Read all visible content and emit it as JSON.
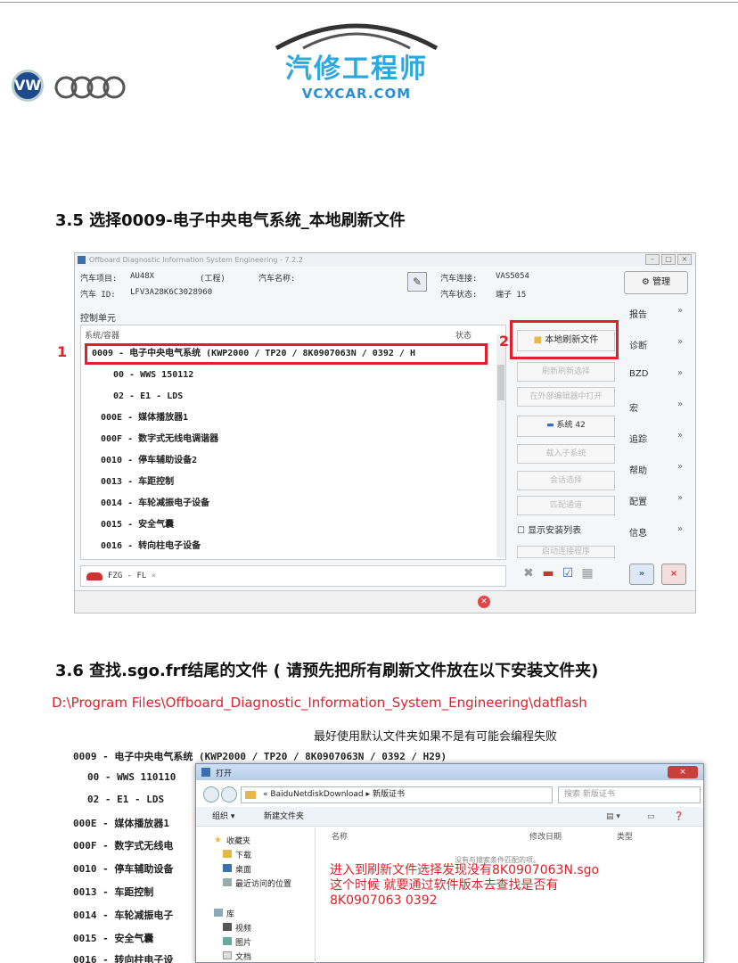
{
  "header": {
    "brand_cn": "汽修工程师",
    "brand_en": "VCXCAR.COM",
    "vw_logo": "VW",
    "audi_logo": "audi-rings"
  },
  "section1": {
    "heading": "3.5 选择0009-电子中央电气系统_本地刷新文件"
  },
  "window": {
    "title": "Offboard Diagnostic Information System Engineering - 7.2.2",
    "min": "–",
    "max": "□",
    "close": "×",
    "project_label": "汽车项目:",
    "project_value": "AU48X",
    "project_extra": "(工程)",
    "id_label": "汽车 ID:",
    "id_value": "LFV3A28K6C3028960",
    "name_label": "汽车名称:",
    "conn_label": "汽车连接:",
    "conn_value": "VAS5054",
    "state_label": "汽车状态:",
    "state_value": "端子 15",
    "mgmt_label": "管理",
    "control_units_label": "控制单元",
    "col_system": "系统/容器",
    "col_status": "状态",
    "rows": [
      "0009 - 电子中央电气系统  (KWP2000 / TP20 / 8K0907063N / 0392 / H",
      "00 - WWS 150112",
      "02 - E1 - LDS",
      "000E - 媒体播放器1",
      "000F - 数字式无线电调谐器",
      "0010 - 停车辅助设备2",
      "0013 - 车距控制",
      "0014 - 车轮减振电子设备",
      "0015 - 安全气囊",
      "0016 - 转向柱电子设备"
    ],
    "marker1": "1",
    "marker2": "2",
    "btn_local_flash": "本地刷新文件",
    "btn_refresh_sel": "刷新刷新选择",
    "btn_open_external": "在外部编辑器中打开",
    "btn_system": "系统 42",
    "btn_add_sub": "载入子系统",
    "btn_session": "会话选择",
    "btn_match": "匹配通道",
    "chk_show_install": "显示安装列表",
    "btn_last": "启动连接程序",
    "side_items": [
      "报告",
      "诊断",
      "BZD",
      "宏",
      "追踪",
      "帮助",
      "配置",
      "信息"
    ],
    "tab_label": "FZG - FL",
    "tab_close": "×",
    "forward_icon": "»",
    "stop_icon": "×"
  },
  "section2": {
    "heading": "3.6 查找.sgo.frf结尾的文件 ( 请预先把所有刷新文件放在以下安装文件夹)",
    "path": "D:\\Program Files\\Offboard_Diagnostic_Information_System_Engineering\\datflash",
    "note": "最好使用默认文件夹如果不是有可能会编程失败",
    "rows": [
      "0009 - 电子中央电气系统  (KWP2000 / TP20 / 8K0907063N / 0392 / H29)",
      "00 - WWS 110110",
      "02 - E1 - LDS",
      "000E - 媒体播放器1",
      "000F - 数字式无线电",
      "0010 - 停车辅助设备",
      "0013 - 车距控制",
      "0014 - 车轮减振电子",
      "0015 - 安全气囊",
      "0016 - 转向柱电子设"
    ]
  },
  "dialog": {
    "title": "打开",
    "close": "×",
    "path_prefix": "«",
    "path_a": "BaiduNetdiskDownload",
    "path_sep": "▸",
    "path_b": "新版证书",
    "search_placeholder": "搜索 新版证书",
    "organize": "组织 ▾",
    "new_folder": "新建文件夹",
    "nav_favorites": "收藏夹",
    "nav_downloads": "下载",
    "nav_desktop": "桌面",
    "nav_recent": "最近访问的位置",
    "nav_library": "库",
    "nav_video": "视频",
    "nav_pictures": "图片",
    "nav_docs": "文档",
    "col_name": "名称",
    "col_date": "修改日期",
    "col_type": "类型",
    "empty": "没有与搜索条件匹配的项。",
    "red_line1": "进入到刷新文件选择发现没有8K0907063N.sgo",
    "red_line2": "这个时候 就要通过软件版本去查找是否有",
    "red_line3": "8K0907063  0392"
  }
}
